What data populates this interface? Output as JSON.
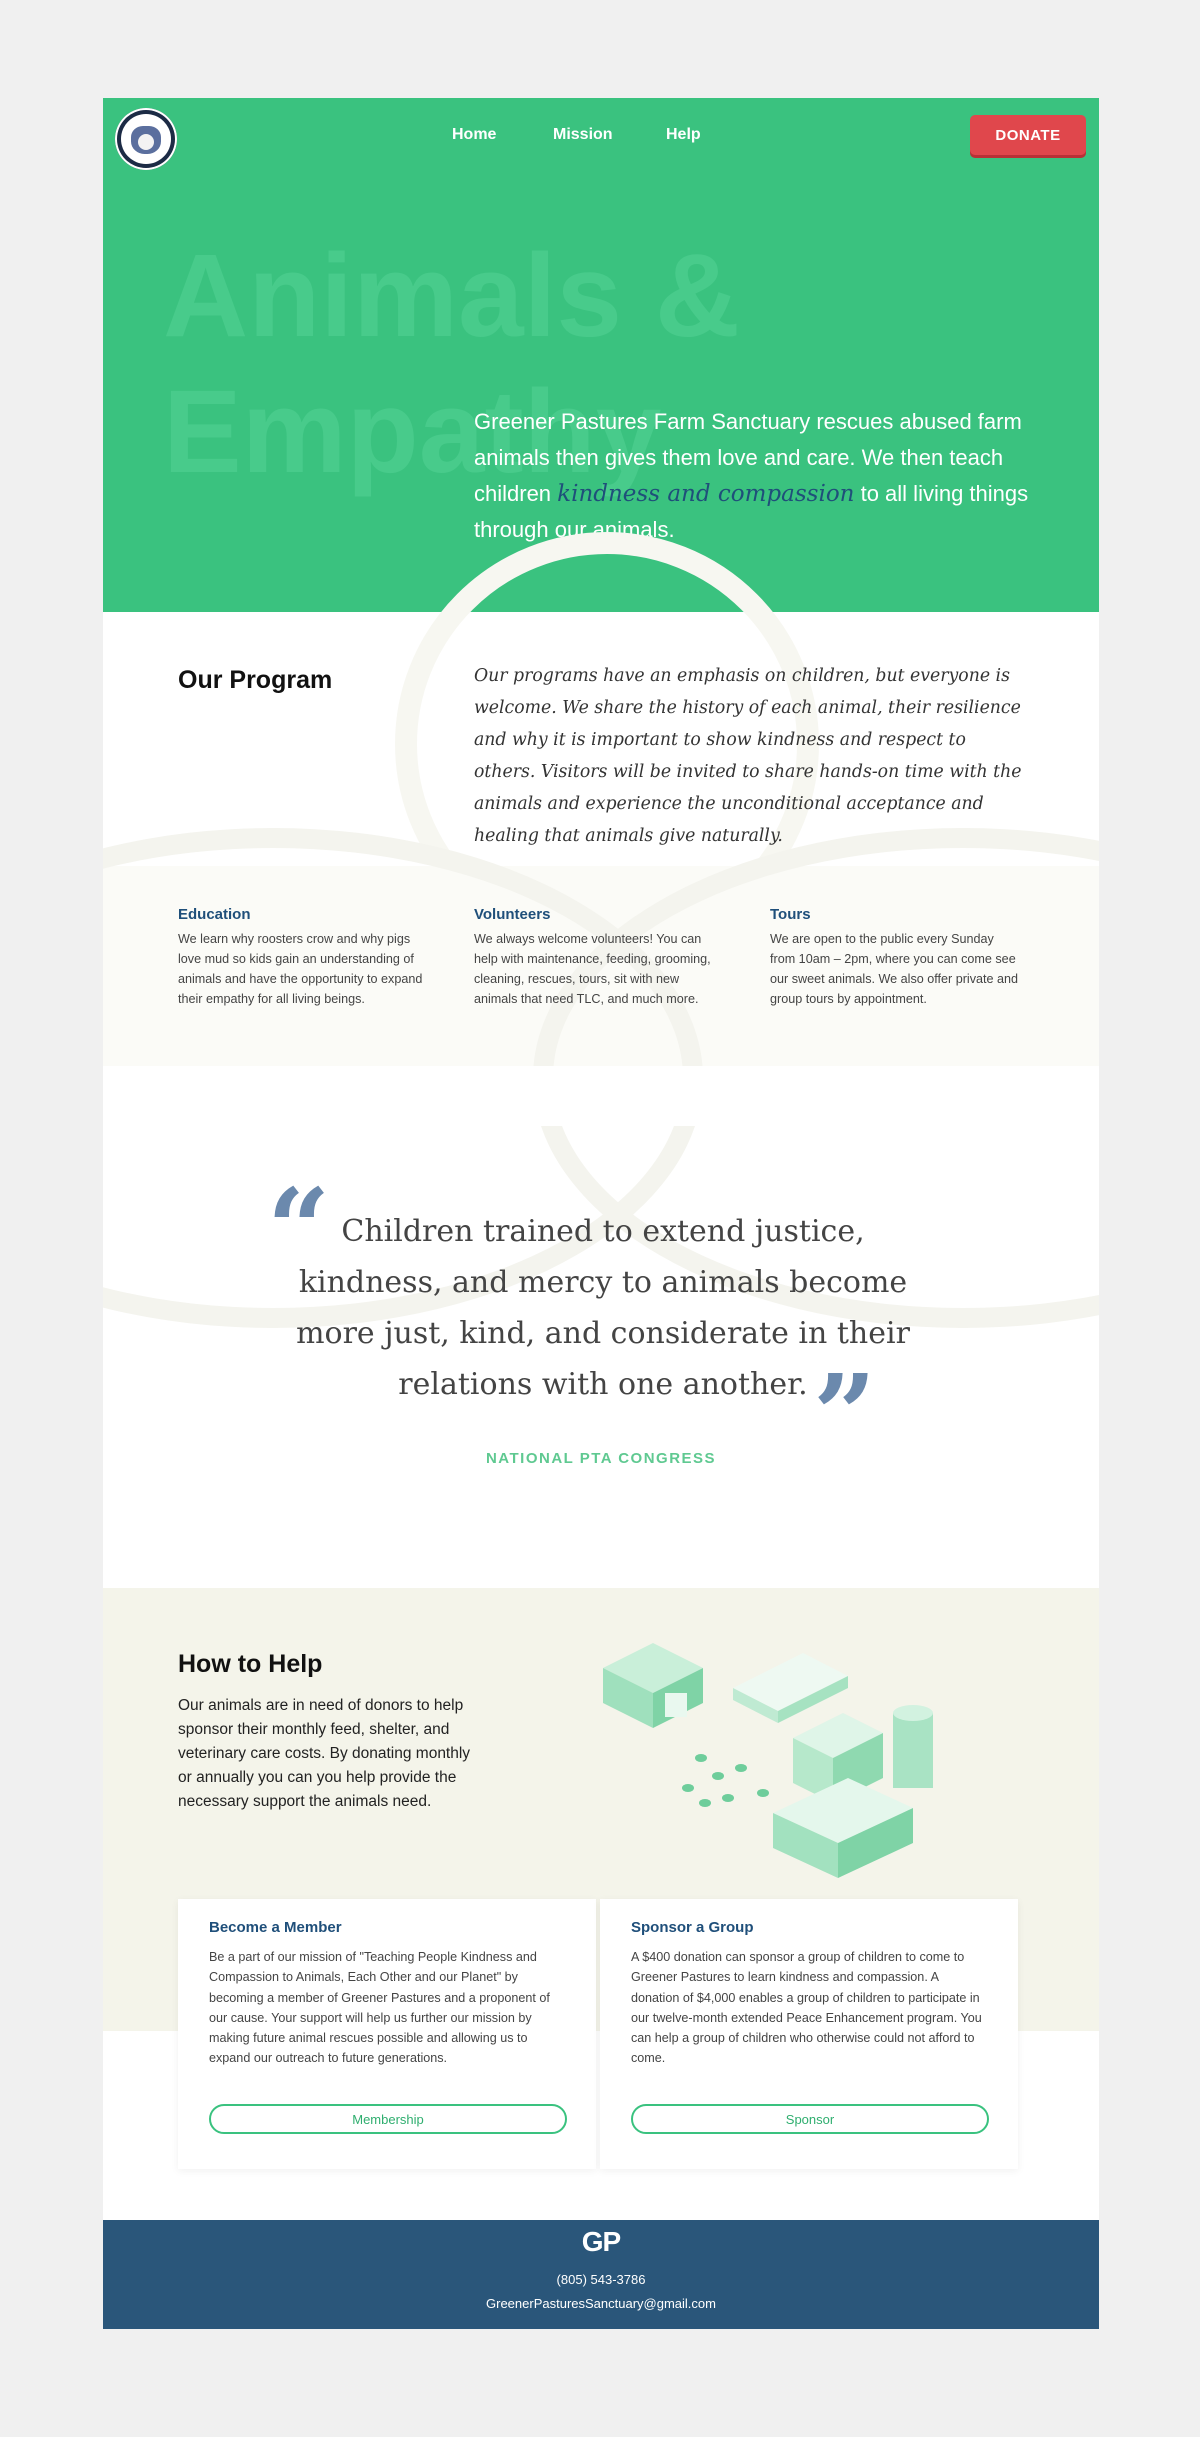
{
  "nav": {
    "logo_alt": "GREENER PASTURES FARM SANCTUARY",
    "home": "Home",
    "mission": "Mission",
    "help": "Help",
    "donate": "DONATE"
  },
  "hero": {
    "bg_line1": "Animals &",
    "bg_line2": "Empathy",
    "text_before": "Greener Pastures Farm Sanctuary rescues abused farm animals then gives them love and care. We then teach children ",
    "text_emphasis": "kindness and compassion",
    "text_after": " to all living things through our animals."
  },
  "program": {
    "title": "Our Program",
    "text": "Our programs have an emphasis on children, but everyone is welcome. We share the history of each animal, their resilience and why it is important to show kindness and respect to others. Visitors will be invited to share hands-on time with the animals and experience the unconditional acceptance and healing that animals give naturally.",
    "columns": [
      {
        "title": "Education",
        "text": "We learn why roosters crow and why pigs love mud so kids gain an understanding of animals and have the opportunity to expand their empathy for all living beings."
      },
      {
        "title": "Volunteers",
        "text": "We always welcome volunteers! You can help with maintenance, feeding, grooming, cleaning, rescues, tours, sit with new animals that need TLC, and much more."
      },
      {
        "title": "Tours",
        "text": "We are open to the public every Sunday from 10am – 2pm, where you can come see our sweet animals. We also offer private and group tours by appointment."
      }
    ]
  },
  "quote": {
    "text": "Children trained to extend justice, kindness, and mercy to animals become more just, kind, and considerate in their relations with one another.",
    "source": "NATIONAL PTA CONGRESS"
  },
  "help": {
    "title": "How to Help",
    "text": "Our animals are in need of donors to help sponsor their monthly feed, shelter, and veterinary care costs. By donating monthly or annually you can you help provide the necessary support the animals need.",
    "cards": [
      {
        "title": "Become a Member",
        "text": "Be a part of our mission of \"Teaching People Kindness and Compassion to Animals, Each Other and our Planet\" by becoming a member of Greener Pastures and a proponent of our cause. Your support will help us further our mission by making future animal rescues possible and allowing us to expand our outreach to future generations.",
        "button": "Membership"
      },
      {
        "title": "Sponsor a Group",
        "text": "A $400 donation can sponsor a group of children to come to Greener Pastures to learn kindness and compassion. A donation of $4,000 enables a group of children to participate in our twelve-month extended Peace Enhancement program. You can help a group of children who otherwise could not afford to come.",
        "button": "Sponsor"
      }
    ]
  },
  "footer": {
    "logo": "GP",
    "phone": "(805) 543-3786",
    "email": "GreenerPasturesSanctuary@gmail.com"
  },
  "colors": {
    "brand_green": "#3ac27f",
    "navy": "#2a567a",
    "donate_red": "#e0474c",
    "link_blue": "#1f4f7a"
  }
}
